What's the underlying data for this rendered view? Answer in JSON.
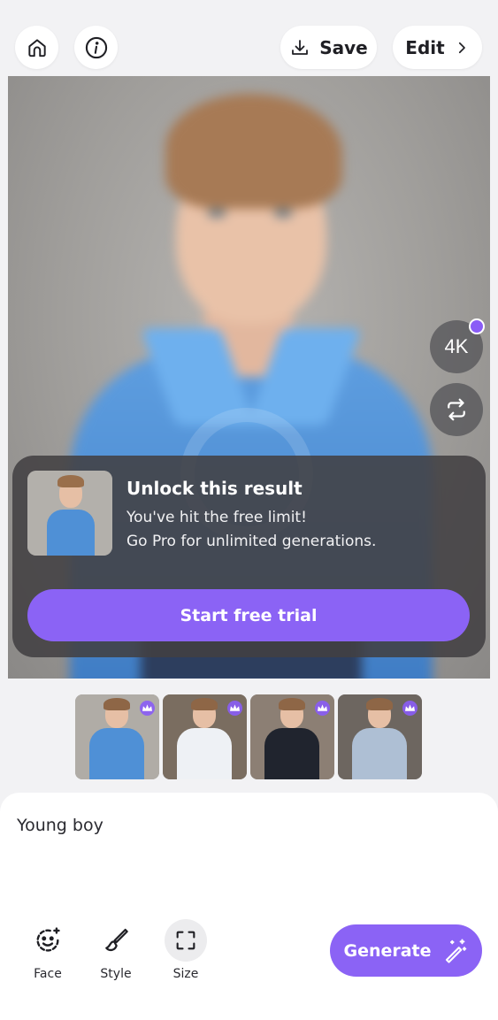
{
  "topbar": {
    "home_icon": "home-icon",
    "info_icon": "info-icon",
    "save_label": "Save",
    "edit_label": "Edit"
  },
  "photo": {
    "side_buttons": {
      "upscale_label": "4K",
      "swap_icon": "swap-icon"
    }
  },
  "unlock": {
    "title": "Unlock this result",
    "line1": "You've hit the free limit!",
    "line2": "Go Pro for unlimited generations.",
    "cta": "Start free trial"
  },
  "thumbnails": [
    {
      "shirt_color": "#4f90d6",
      "bg": "#b0aca6"
    },
    {
      "shirt_color": "#eef1f5",
      "bg": "#7a6d60"
    },
    {
      "shirt_color": "#20242e",
      "bg": "#8c7f74"
    },
    {
      "shirt_color": "#aebfd4",
      "bg": "#6d6660"
    }
  ],
  "panel": {
    "prompt": "Young boy",
    "tools": [
      {
        "label": "Face",
        "icon": "face-icon"
      },
      {
        "label": "Style",
        "icon": "brush-icon"
      },
      {
        "label": "Size",
        "icon": "size-icon"
      }
    ],
    "generate_label": "Generate"
  },
  "colors": {
    "accent": "#8b63f5"
  }
}
